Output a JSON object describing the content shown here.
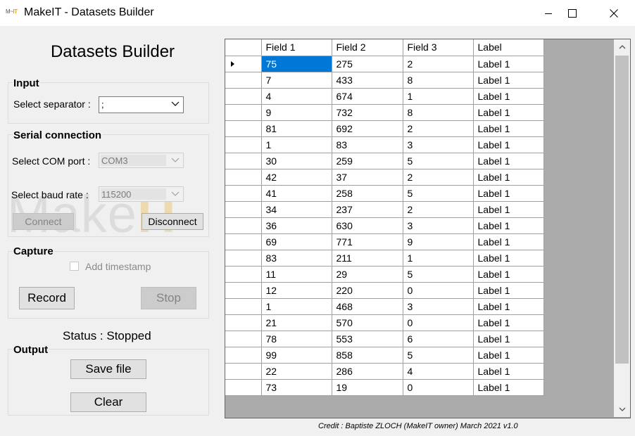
{
  "window": {
    "title": "MakeIT - Datasets Builder",
    "icon_text": "MakeIT"
  },
  "page_title": "Datasets Builder",
  "input": {
    "legend": "Input",
    "separator_label": "Select separator :",
    "separator_value": ";"
  },
  "serial": {
    "legend": "Serial connection",
    "com_label": "Select COM port :",
    "com_value": "COM3",
    "baud_label": "Select baud rate :",
    "baud_value": "115200",
    "connect_label": "Connect",
    "disconnect_label": "Disconnect"
  },
  "watermark": {
    "part1": "Make",
    "part2": "IT"
  },
  "capture": {
    "legend": "Capture",
    "timestamp_label": "Add timestamp",
    "timestamp_checked": false,
    "record_label": "Record",
    "stop_label": "Stop"
  },
  "status_text": "Status : Stopped",
  "output": {
    "legend": "Output",
    "save_label": "Save file",
    "clear_label": "Clear"
  },
  "grid": {
    "columns": [
      "Field 1",
      "Field 2",
      "Field 3",
      "Label"
    ],
    "rows": [
      [
        "75",
        "275",
        "2",
        "Label 1"
      ],
      [
        "7",
        "433",
        "8",
        "Label 1"
      ],
      [
        "4",
        "674",
        "1",
        "Label 1"
      ],
      [
        "9",
        "732",
        "8",
        "Label 1"
      ],
      [
        "81",
        "692",
        "2",
        "Label 1"
      ],
      [
        "1",
        "83",
        "3",
        "Label 1"
      ],
      [
        "30",
        "259",
        "5",
        "Label 1"
      ],
      [
        "42",
        "37",
        "2",
        "Label 1"
      ],
      [
        "41",
        "258",
        "5",
        "Label 1"
      ],
      [
        "34",
        "237",
        "2",
        "Label 1"
      ],
      [
        "36",
        "630",
        "3",
        "Label 1"
      ],
      [
        "69",
        "771",
        "9",
        "Label 1"
      ],
      [
        "83",
        "211",
        "1",
        "Label 1"
      ],
      [
        "11",
        "29",
        "5",
        "Label 1"
      ],
      [
        "12",
        "220",
        "0",
        "Label 1"
      ],
      [
        "1",
        "468",
        "3",
        "Label 1"
      ],
      [
        "21",
        "570",
        "0",
        "Label 1"
      ],
      [
        "78",
        "553",
        "6",
        "Label 1"
      ],
      [
        "99",
        "858",
        "5",
        "Label 1"
      ],
      [
        "22",
        "286",
        "4",
        "Label 1"
      ],
      [
        "73",
        "19",
        "0",
        "Label 1"
      ]
    ],
    "selected_row": 0,
    "selected_cell": 0
  },
  "credit": "Credit : Baptiste ZLOCH (MakeIT owner) March 2021 v1.0",
  "colors": {
    "selection": "#0078d7",
    "accent": "#e8a010"
  }
}
